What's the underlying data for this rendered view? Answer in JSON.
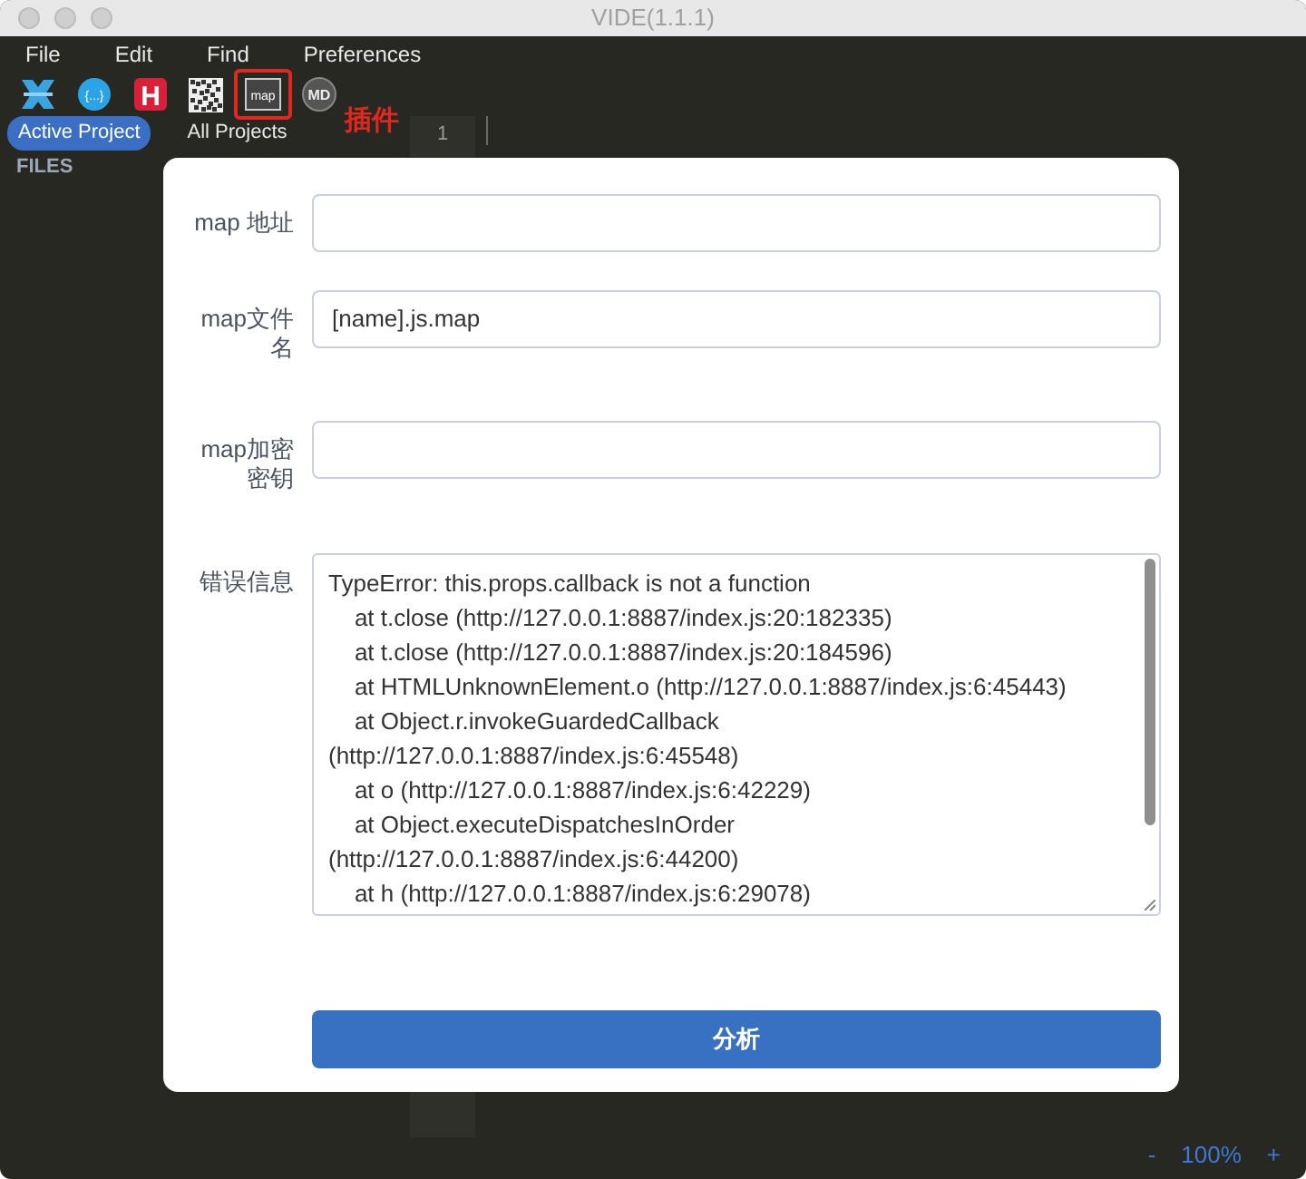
{
  "window": {
    "title": "VIDE(1.1.1)"
  },
  "menu": [
    "File",
    "Edit",
    "Find",
    "Preferences"
  ],
  "toolbar": [
    {
      "kind": "cross",
      "highlighted": false
    },
    {
      "kind": "braces",
      "label": "{...}",
      "highlighted": false
    },
    {
      "kind": "h",
      "label": "H",
      "highlighted": false
    },
    {
      "kind": "qr",
      "highlighted": false
    },
    {
      "kind": "map",
      "label": "map",
      "highlighted": true
    },
    {
      "kind": "md",
      "label": "MD",
      "highlighted": false
    }
  ],
  "annotation": "插件",
  "project_tabs": [
    {
      "label": "Active Project",
      "selected": true
    },
    {
      "label": "All Projects",
      "selected": false
    }
  ],
  "sidebar": {
    "heading": "FILES"
  },
  "editor": {
    "line_numbers": [
      "1"
    ]
  },
  "dialog": {
    "fields": [
      {
        "kind": "input",
        "label": "map 地址"
      },
      {
        "kind": "input",
        "label": "map文件名",
        "value": "[name].js.map"
      },
      {
        "kind": "input",
        "label": "map加密密钥"
      },
      {
        "kind": "textarea",
        "label": "错误信息",
        "value": "TypeError: this.props.callback is not a function\n    at t.close (http://127.0.0.1:8887/index.js:20:182335)\n    at t.close (http://127.0.0.1:8887/index.js:20:184596)\n    at HTMLUnknownElement.o (http://127.0.0.1:8887/index.js:6:45443)\n    at Object.r.invokeGuardedCallback\n(http://127.0.0.1:8887/index.js:6:45548)\n    at o (http://127.0.0.1:8887/index.js:6:42229)\n    at Object.executeDispatchesInOrder\n(http://127.0.0.1:8887/index.js:6:44200)\n    at h (http://127.0.0.1:8887/index.js:6:29078)"
      }
    ],
    "submit": "分析"
  },
  "zoom": {
    "minus": "-",
    "level": "100%",
    "plus": "+"
  }
}
